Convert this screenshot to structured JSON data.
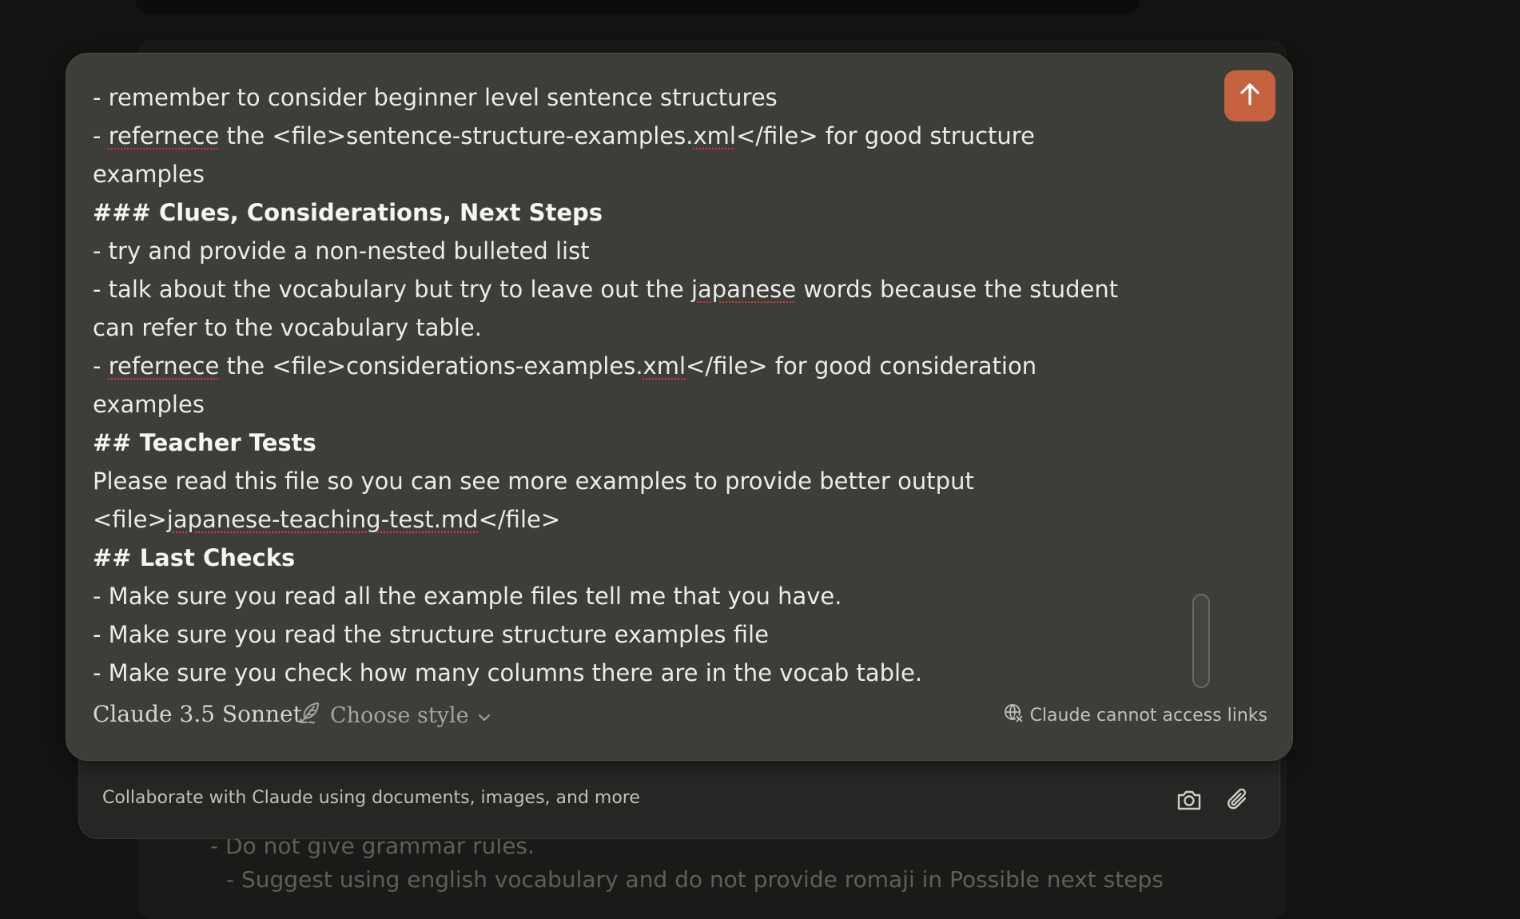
{
  "editor": {
    "lines": [
      {
        "segments": [
          {
            "text": "- remember to consider beginner level sentence structures"
          }
        ]
      },
      {
        "segments": [
          {
            "text": "- "
          },
          {
            "text": "refernece",
            "spell": true
          },
          {
            "text": " the <file>sentence-structure-examples."
          },
          {
            "text": "xml",
            "spell": true
          },
          {
            "text": "</file> for good structure"
          }
        ]
      },
      {
        "segments": [
          {
            "text": "examples"
          }
        ]
      },
      {
        "heading": true,
        "segments": [
          {
            "text": "### Clues, Considerations, Next Steps"
          }
        ]
      },
      {
        "segments": [
          {
            "text": "- try and provide a non-nested bulleted list"
          }
        ]
      },
      {
        "segments": [
          {
            "text": "- talk about the vocabulary but try to leave out the "
          },
          {
            "text": "japanese",
            "spell": true
          },
          {
            "text": " words because the student"
          }
        ]
      },
      {
        "segments": [
          {
            "text": "can refer to the vocabulary table."
          }
        ]
      },
      {
        "segments": [
          {
            "text": "- "
          },
          {
            "text": "refernece",
            "spell": true
          },
          {
            "text": " the <file>considerations-examples."
          },
          {
            "text": "xml",
            "spell": true
          },
          {
            "text": "</file> for good consideration"
          }
        ]
      },
      {
        "segments": [
          {
            "text": "examples"
          }
        ]
      },
      {
        "heading": true,
        "segments": [
          {
            "text": "## Teacher Tests"
          }
        ]
      },
      {
        "segments": [
          {
            "text": "Please read this file so you can see more examples to provide better output"
          }
        ]
      },
      {
        "segments": [
          {
            "text": "<file>"
          },
          {
            "text": "japanese-teaching-test.md",
            "spell": true
          },
          {
            "text": "</file>"
          }
        ]
      },
      {
        "heading": true,
        "segments": [
          {
            "text": "## Last Checks"
          }
        ]
      },
      {
        "segments": [
          {
            "text": "- Make sure you read all the example files tell me that you have."
          }
        ]
      },
      {
        "segments": [
          {
            "text": "- Make sure you read the structure structure examples file"
          }
        ]
      },
      {
        "segments": [
          {
            "text": "- Make sure you check how many columns there are in the vocab table."
          }
        ]
      }
    ]
  },
  "composer": {
    "model_name": "Claude 3.5 Sonnet",
    "style_label": "Choose style",
    "links_note": "Claude cannot access links",
    "send_icon": "arrow-up-icon"
  },
  "attach_bar": {
    "placeholder": "Collaborate with Claude using documents, images, and more",
    "icons": [
      "camera-icon",
      "paperclip-icon"
    ]
  },
  "background": {
    "lines": [
      "- Do not give grammar rules.",
      "- Suggest using english vocabulary and do not provide romaji in Possible next steps"
    ]
  },
  "colors": {
    "accent": "#c6613f",
    "composer_bg": "#3d3d3a",
    "page_bg": "#131312",
    "spellcheck": "#e0363f"
  }
}
